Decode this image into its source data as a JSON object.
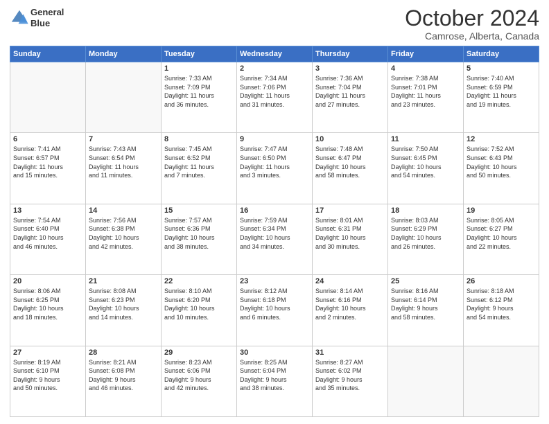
{
  "header": {
    "logo_line1": "General",
    "logo_line2": "Blue",
    "month_title": "October 2024",
    "subtitle": "Camrose, Alberta, Canada"
  },
  "days_of_week": [
    "Sunday",
    "Monday",
    "Tuesday",
    "Wednesday",
    "Thursday",
    "Friday",
    "Saturday"
  ],
  "weeks": [
    [
      {
        "day": "",
        "detail": ""
      },
      {
        "day": "",
        "detail": ""
      },
      {
        "day": "1",
        "detail": "Sunrise: 7:33 AM\nSunset: 7:09 PM\nDaylight: 11 hours\nand 36 minutes."
      },
      {
        "day": "2",
        "detail": "Sunrise: 7:34 AM\nSunset: 7:06 PM\nDaylight: 11 hours\nand 31 minutes."
      },
      {
        "day": "3",
        "detail": "Sunrise: 7:36 AM\nSunset: 7:04 PM\nDaylight: 11 hours\nand 27 minutes."
      },
      {
        "day": "4",
        "detail": "Sunrise: 7:38 AM\nSunset: 7:01 PM\nDaylight: 11 hours\nand 23 minutes."
      },
      {
        "day": "5",
        "detail": "Sunrise: 7:40 AM\nSunset: 6:59 PM\nDaylight: 11 hours\nand 19 minutes."
      }
    ],
    [
      {
        "day": "6",
        "detail": "Sunrise: 7:41 AM\nSunset: 6:57 PM\nDaylight: 11 hours\nand 15 minutes."
      },
      {
        "day": "7",
        "detail": "Sunrise: 7:43 AM\nSunset: 6:54 PM\nDaylight: 11 hours\nand 11 minutes."
      },
      {
        "day": "8",
        "detail": "Sunrise: 7:45 AM\nSunset: 6:52 PM\nDaylight: 11 hours\nand 7 minutes."
      },
      {
        "day": "9",
        "detail": "Sunrise: 7:47 AM\nSunset: 6:50 PM\nDaylight: 11 hours\nand 3 minutes."
      },
      {
        "day": "10",
        "detail": "Sunrise: 7:48 AM\nSunset: 6:47 PM\nDaylight: 10 hours\nand 58 minutes."
      },
      {
        "day": "11",
        "detail": "Sunrise: 7:50 AM\nSunset: 6:45 PM\nDaylight: 10 hours\nand 54 minutes."
      },
      {
        "day": "12",
        "detail": "Sunrise: 7:52 AM\nSunset: 6:43 PM\nDaylight: 10 hours\nand 50 minutes."
      }
    ],
    [
      {
        "day": "13",
        "detail": "Sunrise: 7:54 AM\nSunset: 6:40 PM\nDaylight: 10 hours\nand 46 minutes."
      },
      {
        "day": "14",
        "detail": "Sunrise: 7:56 AM\nSunset: 6:38 PM\nDaylight: 10 hours\nand 42 minutes."
      },
      {
        "day": "15",
        "detail": "Sunrise: 7:57 AM\nSunset: 6:36 PM\nDaylight: 10 hours\nand 38 minutes."
      },
      {
        "day": "16",
        "detail": "Sunrise: 7:59 AM\nSunset: 6:34 PM\nDaylight: 10 hours\nand 34 minutes."
      },
      {
        "day": "17",
        "detail": "Sunrise: 8:01 AM\nSunset: 6:31 PM\nDaylight: 10 hours\nand 30 minutes."
      },
      {
        "day": "18",
        "detail": "Sunrise: 8:03 AM\nSunset: 6:29 PM\nDaylight: 10 hours\nand 26 minutes."
      },
      {
        "day": "19",
        "detail": "Sunrise: 8:05 AM\nSunset: 6:27 PM\nDaylight: 10 hours\nand 22 minutes."
      }
    ],
    [
      {
        "day": "20",
        "detail": "Sunrise: 8:06 AM\nSunset: 6:25 PM\nDaylight: 10 hours\nand 18 minutes."
      },
      {
        "day": "21",
        "detail": "Sunrise: 8:08 AM\nSunset: 6:23 PM\nDaylight: 10 hours\nand 14 minutes."
      },
      {
        "day": "22",
        "detail": "Sunrise: 8:10 AM\nSunset: 6:20 PM\nDaylight: 10 hours\nand 10 minutes."
      },
      {
        "day": "23",
        "detail": "Sunrise: 8:12 AM\nSunset: 6:18 PM\nDaylight: 10 hours\nand 6 minutes."
      },
      {
        "day": "24",
        "detail": "Sunrise: 8:14 AM\nSunset: 6:16 PM\nDaylight: 10 hours\nand 2 minutes."
      },
      {
        "day": "25",
        "detail": "Sunrise: 8:16 AM\nSunset: 6:14 PM\nDaylight: 9 hours\nand 58 minutes."
      },
      {
        "day": "26",
        "detail": "Sunrise: 8:18 AM\nSunset: 6:12 PM\nDaylight: 9 hours\nand 54 minutes."
      }
    ],
    [
      {
        "day": "27",
        "detail": "Sunrise: 8:19 AM\nSunset: 6:10 PM\nDaylight: 9 hours\nand 50 minutes."
      },
      {
        "day": "28",
        "detail": "Sunrise: 8:21 AM\nSunset: 6:08 PM\nDaylight: 9 hours\nand 46 minutes."
      },
      {
        "day": "29",
        "detail": "Sunrise: 8:23 AM\nSunset: 6:06 PM\nDaylight: 9 hours\nand 42 minutes."
      },
      {
        "day": "30",
        "detail": "Sunrise: 8:25 AM\nSunset: 6:04 PM\nDaylight: 9 hours\nand 38 minutes."
      },
      {
        "day": "31",
        "detail": "Sunrise: 8:27 AM\nSunset: 6:02 PM\nDaylight: 9 hours\nand 35 minutes."
      },
      {
        "day": "",
        "detail": ""
      },
      {
        "day": "",
        "detail": ""
      }
    ]
  ]
}
